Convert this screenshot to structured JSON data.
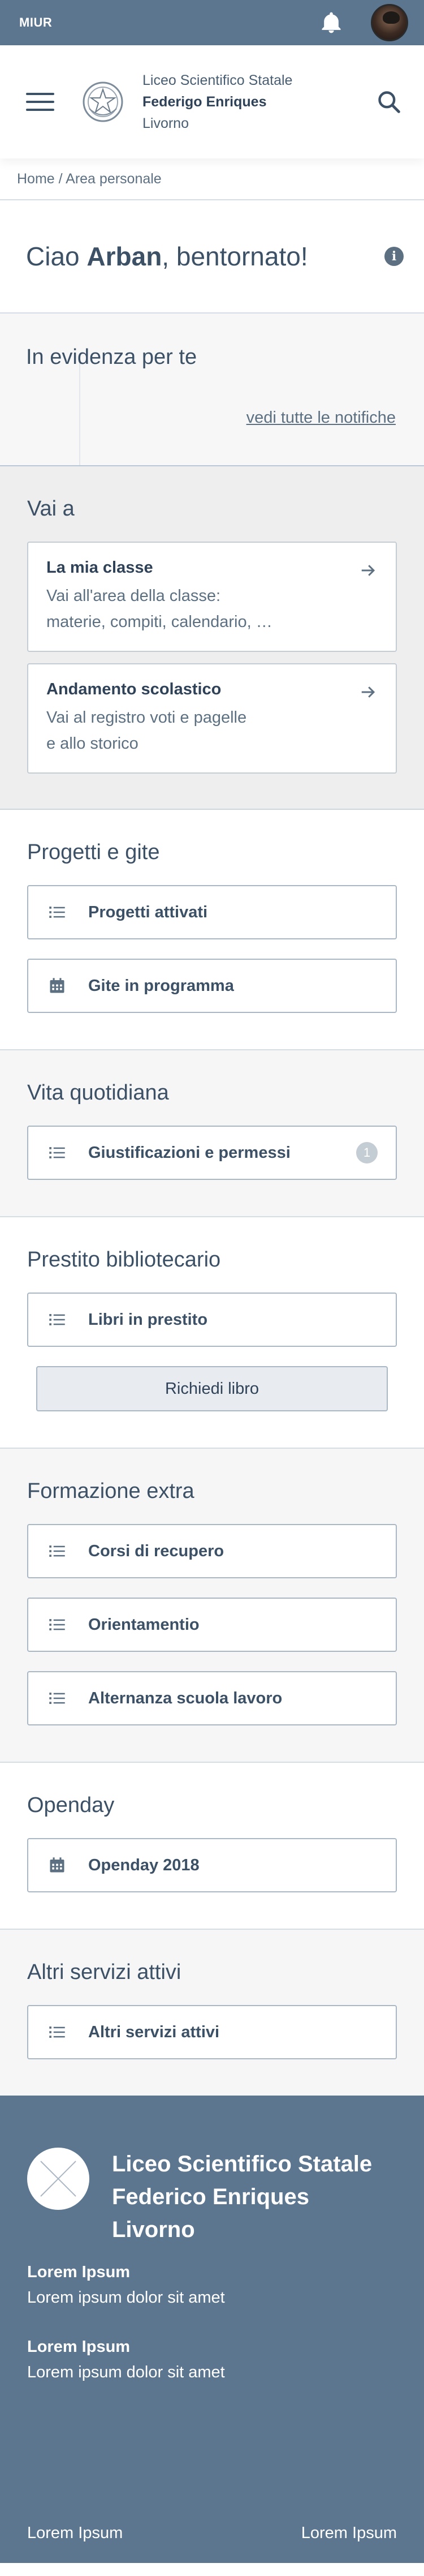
{
  "topbar": {
    "brand": "MIUR",
    "bell_icon": "bell-icon",
    "avatar": "user-avatar"
  },
  "header": {
    "menu_icon": "hamburger-menu-icon",
    "school": {
      "line1": "Liceo Scientifico Statale",
      "line2": "Federigo Enriques",
      "line3": "Livorno"
    },
    "search_icon": "search-icon"
  },
  "breadcrumb": {
    "home": "Home",
    "separator": " / ",
    "current": "Area personale"
  },
  "welcome": {
    "prefix": "Ciao ",
    "name": "Arban",
    "suffix": ", bentornato!",
    "info_icon": "info-icon"
  },
  "highlight": {
    "title": "In evidenza per te",
    "link": "vedi tutte le notifiche"
  },
  "vai_a": {
    "title": "Vai a",
    "cards": [
      {
        "title": "La mia classe",
        "line1": "Vai all'area della classe:",
        "line2": "materie, compiti, calendario, …"
      },
      {
        "title": "Andamento scolastico",
        "line1": "Vai al registro voti e pagelle",
        "line2": "e allo storico"
      }
    ]
  },
  "progetti": {
    "title": "Progetti e gite",
    "items": [
      "Progetti attivati",
      "Gite in programma"
    ]
  },
  "vita": {
    "title": "Vita quotidiana",
    "items": [
      "Giustificazioni e permessi"
    ],
    "badge": "1"
  },
  "prestito": {
    "title": "Prestito bibliotecario",
    "items": [
      "Libri in prestito"
    ],
    "secondary": "Richiedi libro"
  },
  "formazione": {
    "title": "Formazione extra",
    "items": [
      "Corsi di recupero",
      "Orientamentio",
      "Alternanza scuola lavoro"
    ]
  },
  "openday": {
    "title": "Openday",
    "items": [
      "Openday 2018"
    ]
  },
  "altri": {
    "title": "Altri servizi attivi",
    "items": [
      "Altri servizi attivi"
    ]
  },
  "footer": {
    "name1": "Liceo Scientifico Statale",
    "name2": "Federico Enriques",
    "name3": "Livorno",
    "blocks": [
      {
        "title": "Lorem Ipsum",
        "text": "Lorem ipsum dolor sit amet"
      },
      {
        "title": "Lorem Ipsum",
        "text": "Lorem ipsum dolor sit amet"
      }
    ],
    "bottom_left": "Lorem Ipsum",
    "bottom_right": "Lorem Ipsum"
  },
  "colors": {
    "primary": "#5c7690",
    "text": "#3c5066",
    "border": "#aab7c4",
    "grey_bg": "#eeeeee"
  }
}
